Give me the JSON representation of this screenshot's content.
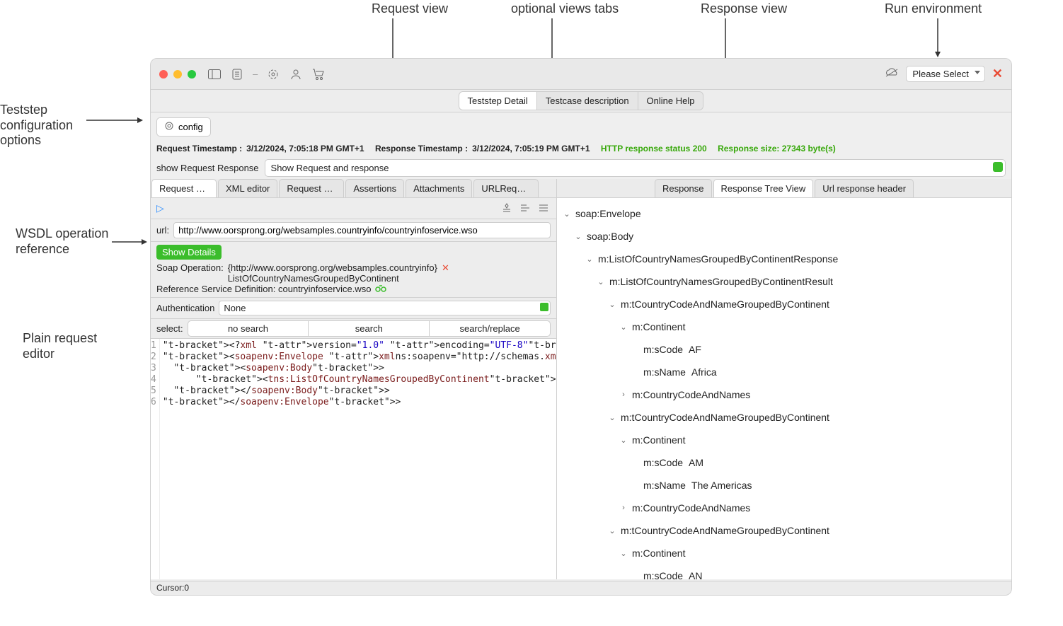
{
  "annotations": {
    "teststep_config": "Teststep\nconfiguration\noptions",
    "wsdl_ref": "WSDL operation\nreference",
    "plain_editor": "Plain request\neditor",
    "request_view": "Request view",
    "optional_views": "optional views tabs",
    "response_view": "Response view",
    "run_env": "Run environment"
  },
  "titlebar": {
    "env_placeholder": "Please Select"
  },
  "top_tabs": [
    "Teststep Detail",
    "Testcase description",
    "Online Help"
  ],
  "config_label": "config",
  "timestamps": {
    "req_label": "Request Timestamp :",
    "req_value": "3/12/2024, 7:05:18 PM GMT+1",
    "resp_label": "Response Timestamp :",
    "resp_value": "3/12/2024, 7:05:19 PM GMT+1",
    "status": "HTTP response status 200",
    "size": "Response size: 27343  byte(s)"
  },
  "show_rr": {
    "label": "show Request Response",
    "value": "Show Request and response"
  },
  "left_tabs": [
    "Request wit…",
    "XML editor",
    "Request wit…",
    "Assertions",
    "Attachments",
    "URLReques…"
  ],
  "url": {
    "label": "url:",
    "value": "http://www.oorsprong.org/websamples.countryinfo/countryinfoservice.wso"
  },
  "details": {
    "button": "Show Details",
    "soap_label": "Soap Operation:",
    "soap_val_line1": "{http://www.oorsprong.org/websamples.countryinfo}",
    "soap_val_line2": "ListOfCountryNamesGroupedByContinent",
    "ref_label": "Reference Service Definition: countryinfoservice.wso"
  },
  "auth": {
    "label": "Authentication",
    "value": "None"
  },
  "search": {
    "label": "select:",
    "opts": [
      "no search",
      "search",
      "search/replace"
    ]
  },
  "code_lines": [
    "<?xml version=\"1.0\" encoding=\"UTF-8\"?>",
    "<soapenv:Envelope xmlns:soapenv=\"http://schemas.xmlsoap.org/soap/",
    "  <soapenv:Body>",
    "      <tns:ListOfCountryNamesGroupedByContinent></tns:ListOfCou",
    "  </soapenv:Body>",
    "</soapenv:Envelope>"
  ],
  "footer": "Cursor:0",
  "right_tabs": [
    "Response",
    "Response Tree View",
    "Url response header"
  ],
  "tree": [
    {
      "d": 0,
      "c": "v",
      "k": "soap:Envelope"
    },
    {
      "d": 1,
      "c": "v",
      "k": "soap:Body"
    },
    {
      "d": 2,
      "c": "v",
      "k": "m:ListOfCountryNamesGroupedByContinentResponse"
    },
    {
      "d": 3,
      "c": "v",
      "k": "m:ListOfCountryNamesGroupedByContinentResult"
    },
    {
      "d": 4,
      "c": "v",
      "k": "m:tCountryCodeAndNameGroupedByContinent"
    },
    {
      "d": 5,
      "c": "v",
      "k": "m:Continent"
    },
    {
      "d": 6,
      "c": "",
      "k": "m:sCode",
      "v": "AF"
    },
    {
      "d": 6,
      "c": "",
      "k": "m:sName",
      "v": "Africa"
    },
    {
      "d": 5,
      "c": ">",
      "k": "m:CountryCodeAndNames"
    },
    {
      "d": 4,
      "c": "v",
      "k": "m:tCountryCodeAndNameGroupedByContinent"
    },
    {
      "d": 5,
      "c": "v",
      "k": "m:Continent"
    },
    {
      "d": 6,
      "c": "",
      "k": "m:sCode",
      "v": "AM"
    },
    {
      "d": 6,
      "c": "",
      "k": "m:sName",
      "v": "The Americas"
    },
    {
      "d": 5,
      "c": ">",
      "k": "m:CountryCodeAndNames"
    },
    {
      "d": 4,
      "c": "v",
      "k": "m:tCountryCodeAndNameGroupedByContinent"
    },
    {
      "d": 5,
      "c": "v",
      "k": "m:Continent"
    },
    {
      "d": 6,
      "c": "",
      "k": "m:sCode",
      "v": "AN"
    }
  ]
}
